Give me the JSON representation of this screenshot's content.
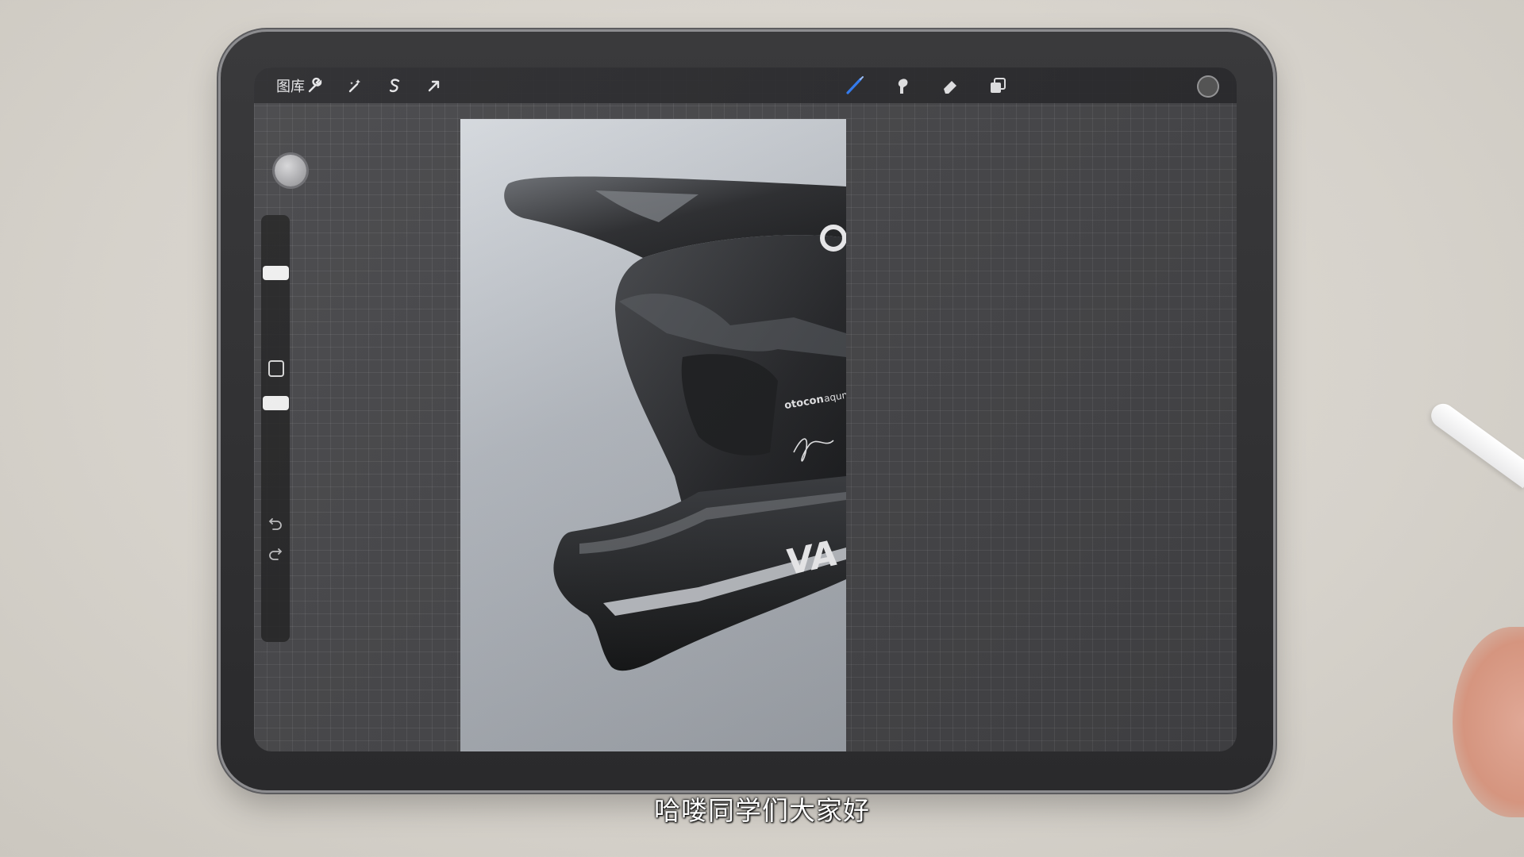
{
  "toolbar": {
    "gallery_label": "图库",
    "left_tools": [
      "wrench-icon",
      "magic-wand-icon",
      "selection-icon",
      "transform-arrow-icon"
    ],
    "right_tools": [
      "brush-icon",
      "smudge-icon",
      "eraser-icon",
      "layers-icon",
      "color-circle"
    ],
    "active_tool_color": "#2f7bf5"
  },
  "sidebar": {
    "size_slider_level": 0.22,
    "opacity_slider_level": 0.18
  },
  "canvas": {
    "logo_text": "otocon",
    "logo_sub": "aqun",
    "stripe_text": "VA"
  },
  "subtitle": "哈喽同学们大家好"
}
